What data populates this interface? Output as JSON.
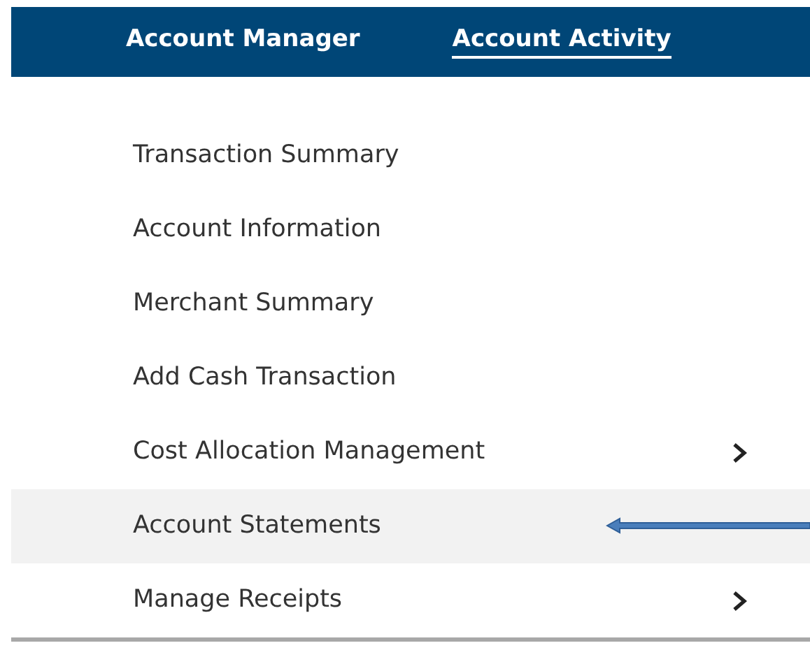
{
  "tabs": [
    {
      "label": "Account Manager",
      "selected": false
    },
    {
      "label": "Account Activity",
      "selected": true
    }
  ],
  "menu": [
    {
      "label": "Transaction Summary",
      "selected": false,
      "has_submenu": false
    },
    {
      "label": "Account Information",
      "selected": false,
      "has_submenu": false
    },
    {
      "label": "Merchant Summary",
      "selected": false,
      "has_submenu": false
    },
    {
      "label": "Add Cash Transaction",
      "selected": false,
      "has_submenu": false
    },
    {
      "label": "Cost Allocation Management",
      "selected": false,
      "has_submenu": true
    },
    {
      "label": "Account Statements",
      "selected": true,
      "has_submenu": false
    },
    {
      "label": "Manage Receipts",
      "selected": false,
      "has_submenu": true
    }
  ]
}
